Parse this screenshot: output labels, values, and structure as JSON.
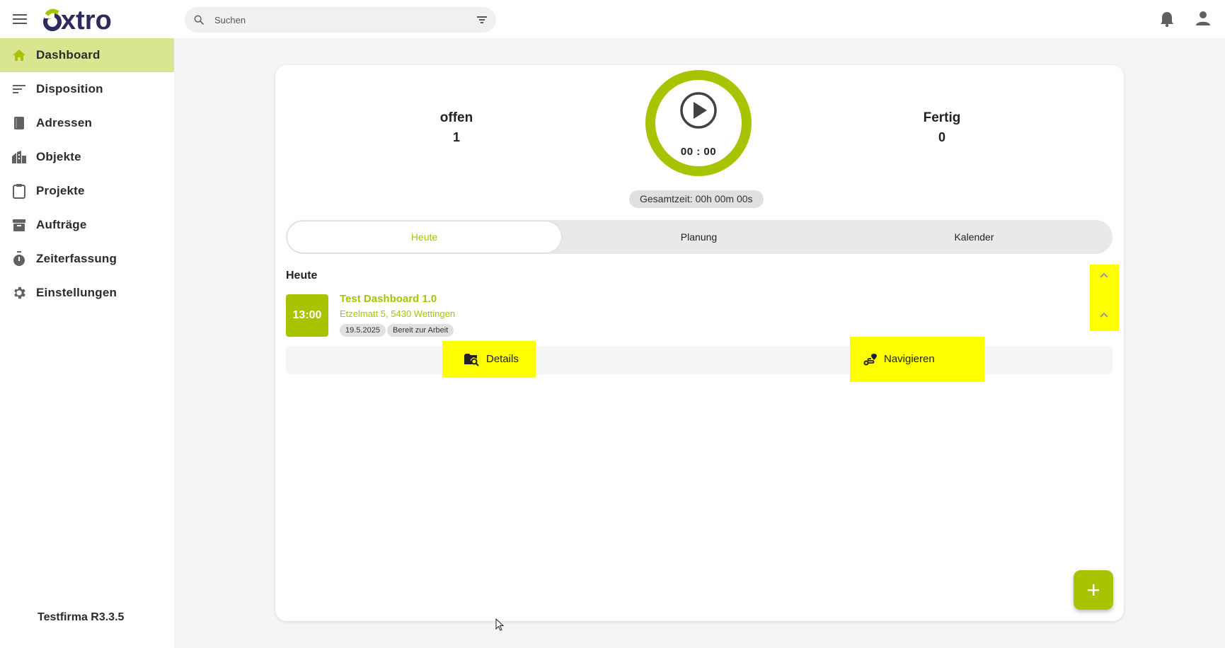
{
  "app": {
    "logo_text": "extro",
    "brand_color": "#a8c400",
    "highlight_color": "#ffff00"
  },
  "search": {
    "placeholder": "Suchen"
  },
  "sidebar": {
    "items": [
      {
        "label": "Dashboard",
        "icon": "home-icon",
        "active": true
      },
      {
        "label": "Disposition",
        "icon": "sort-lines-icon"
      },
      {
        "label": "Adressen",
        "icon": "book-icon"
      },
      {
        "label": "Objekte",
        "icon": "buildings-icon"
      },
      {
        "label": "Projekte",
        "icon": "clipboard-icon"
      },
      {
        "label": "Aufträge",
        "icon": "archive-icon"
      },
      {
        "label": "Zeiterfassung",
        "icon": "stopwatch-icon"
      },
      {
        "label": "Einstellungen",
        "icon": "gear-icon"
      }
    ],
    "version": "Testfirma R3.3.5"
  },
  "stats": {
    "open_label": "offen",
    "open_value": "1",
    "done_label": "Fertig",
    "done_value": "0"
  },
  "timer": {
    "time": "00 : 00",
    "total": "Gesamtzeit: 00h 00m 00s"
  },
  "tabs": [
    {
      "label": "Heute",
      "active": true
    },
    {
      "label": "Planung"
    },
    {
      "label": "Kalender"
    }
  ],
  "today": {
    "section_title": "Heute",
    "job": {
      "time": "13:00",
      "title": "Test Dashboard 1.0",
      "address": "Etzelmatt 5, 5430 Wettingen",
      "date_chip": "19.5.2025",
      "status_chip": "Bereit zur Arbeit"
    },
    "actions": {
      "details_label": "Details",
      "navigate_label": "Navigieren"
    }
  }
}
